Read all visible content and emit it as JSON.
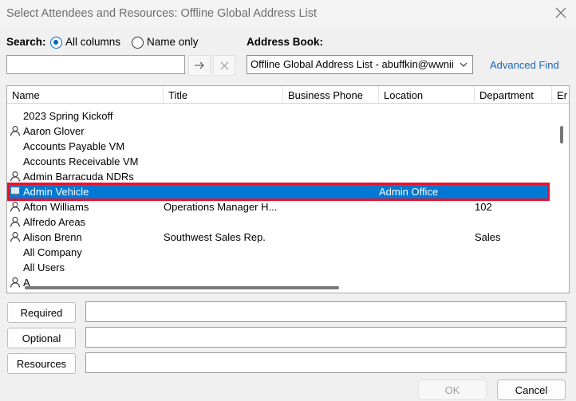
{
  "window": {
    "title": "Select Attendees and Resources: Offline Global Address List",
    "close_icon": "close-icon"
  },
  "search": {
    "label": "Search:",
    "mode_all_label": "All columns",
    "mode_name_label": "Name only",
    "selected_mode": "All columns",
    "value": "",
    "go_icon": "arrow-right-icon",
    "clear_icon": "close-icon"
  },
  "address_book": {
    "label": "Address Book:",
    "selected": "Offline Global Address List - abuffkin@wwnii"
  },
  "advanced_find_label": "Advanced Find",
  "columns": [
    "Name",
    "Title",
    "Business Phone",
    "Location",
    "Department",
    "Er"
  ],
  "rows": [
    {
      "icon": "",
      "name": "2023 Spring Kickoff",
      "title": "",
      "phone": "",
      "location": "",
      "department": ""
    },
    {
      "icon": "person-icon",
      "name": "Aaron Glover",
      "title": "",
      "phone": "",
      "location": "",
      "department": ""
    },
    {
      "icon": "",
      "name": "Accounts Payable VM",
      "title": "",
      "phone": "",
      "location": "",
      "department": ""
    },
    {
      "icon": "",
      "name": "Accounts Receivable VM",
      "title": "",
      "phone": "",
      "location": "",
      "department": ""
    },
    {
      "icon": "person-icon",
      "name": "Admin Barracuda NDRs",
      "title": "",
      "phone": "",
      "location": "",
      "department": ""
    },
    {
      "icon": "resource-icon",
      "name": "Admin Vehicle",
      "title": "",
      "phone": "",
      "location": "Admin Office",
      "department": "",
      "selected": true
    },
    {
      "icon": "person-icon",
      "name": "Afton Williams",
      "title": "Operations Manager H...",
      "phone": "",
      "location": "",
      "department": "102"
    },
    {
      "icon": "person-icon",
      "name": "Alfredo Areas",
      "title": "",
      "phone": "",
      "location": "",
      "department": ""
    },
    {
      "icon": "person-icon",
      "name": "Alison Brenn",
      "title": "Southwest Sales Rep.",
      "phone": "",
      "location": "",
      "department": "Sales"
    },
    {
      "icon": "",
      "name": "All Company",
      "title": "",
      "phone": "",
      "location": "",
      "department": ""
    },
    {
      "icon": "",
      "name": "All Users",
      "title": "",
      "phone": "",
      "location": "",
      "department": ""
    },
    {
      "icon": "person-icon",
      "name": "A",
      "title": "",
      "phone": "",
      "location": "",
      "department": ""
    }
  ],
  "recipients": {
    "required_label": "Required",
    "optional_label": "Optional",
    "resources_label": "Resources",
    "required_value": "",
    "optional_value": "",
    "resources_value": ""
  },
  "footer": {
    "ok_label": "OK",
    "cancel_label": "Cancel"
  },
  "colors": {
    "selection": "#0078d4",
    "highlight_outline": "#e8112d",
    "link": "#1565c0",
    "radio_accent": "#0067c0"
  }
}
